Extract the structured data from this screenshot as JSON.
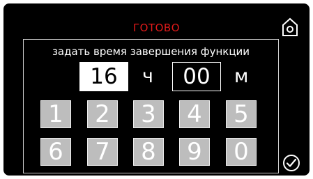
{
  "status": "ГОТОВО",
  "prompt": "задать время завершения функции",
  "time": {
    "hours": "16",
    "hours_unit": "ч",
    "minutes": "00",
    "minutes_unit": "м"
  },
  "keys": [
    "1",
    "2",
    "3",
    "4",
    "5",
    "6",
    "7",
    "8",
    "9",
    "0"
  ],
  "icons": {
    "home": "home-icon",
    "confirm": "check-circle-icon"
  },
  "colors": {
    "background": "#000000",
    "status": "#e01a1a",
    "key": "#bdbdbd",
    "text": "#ffffff"
  }
}
